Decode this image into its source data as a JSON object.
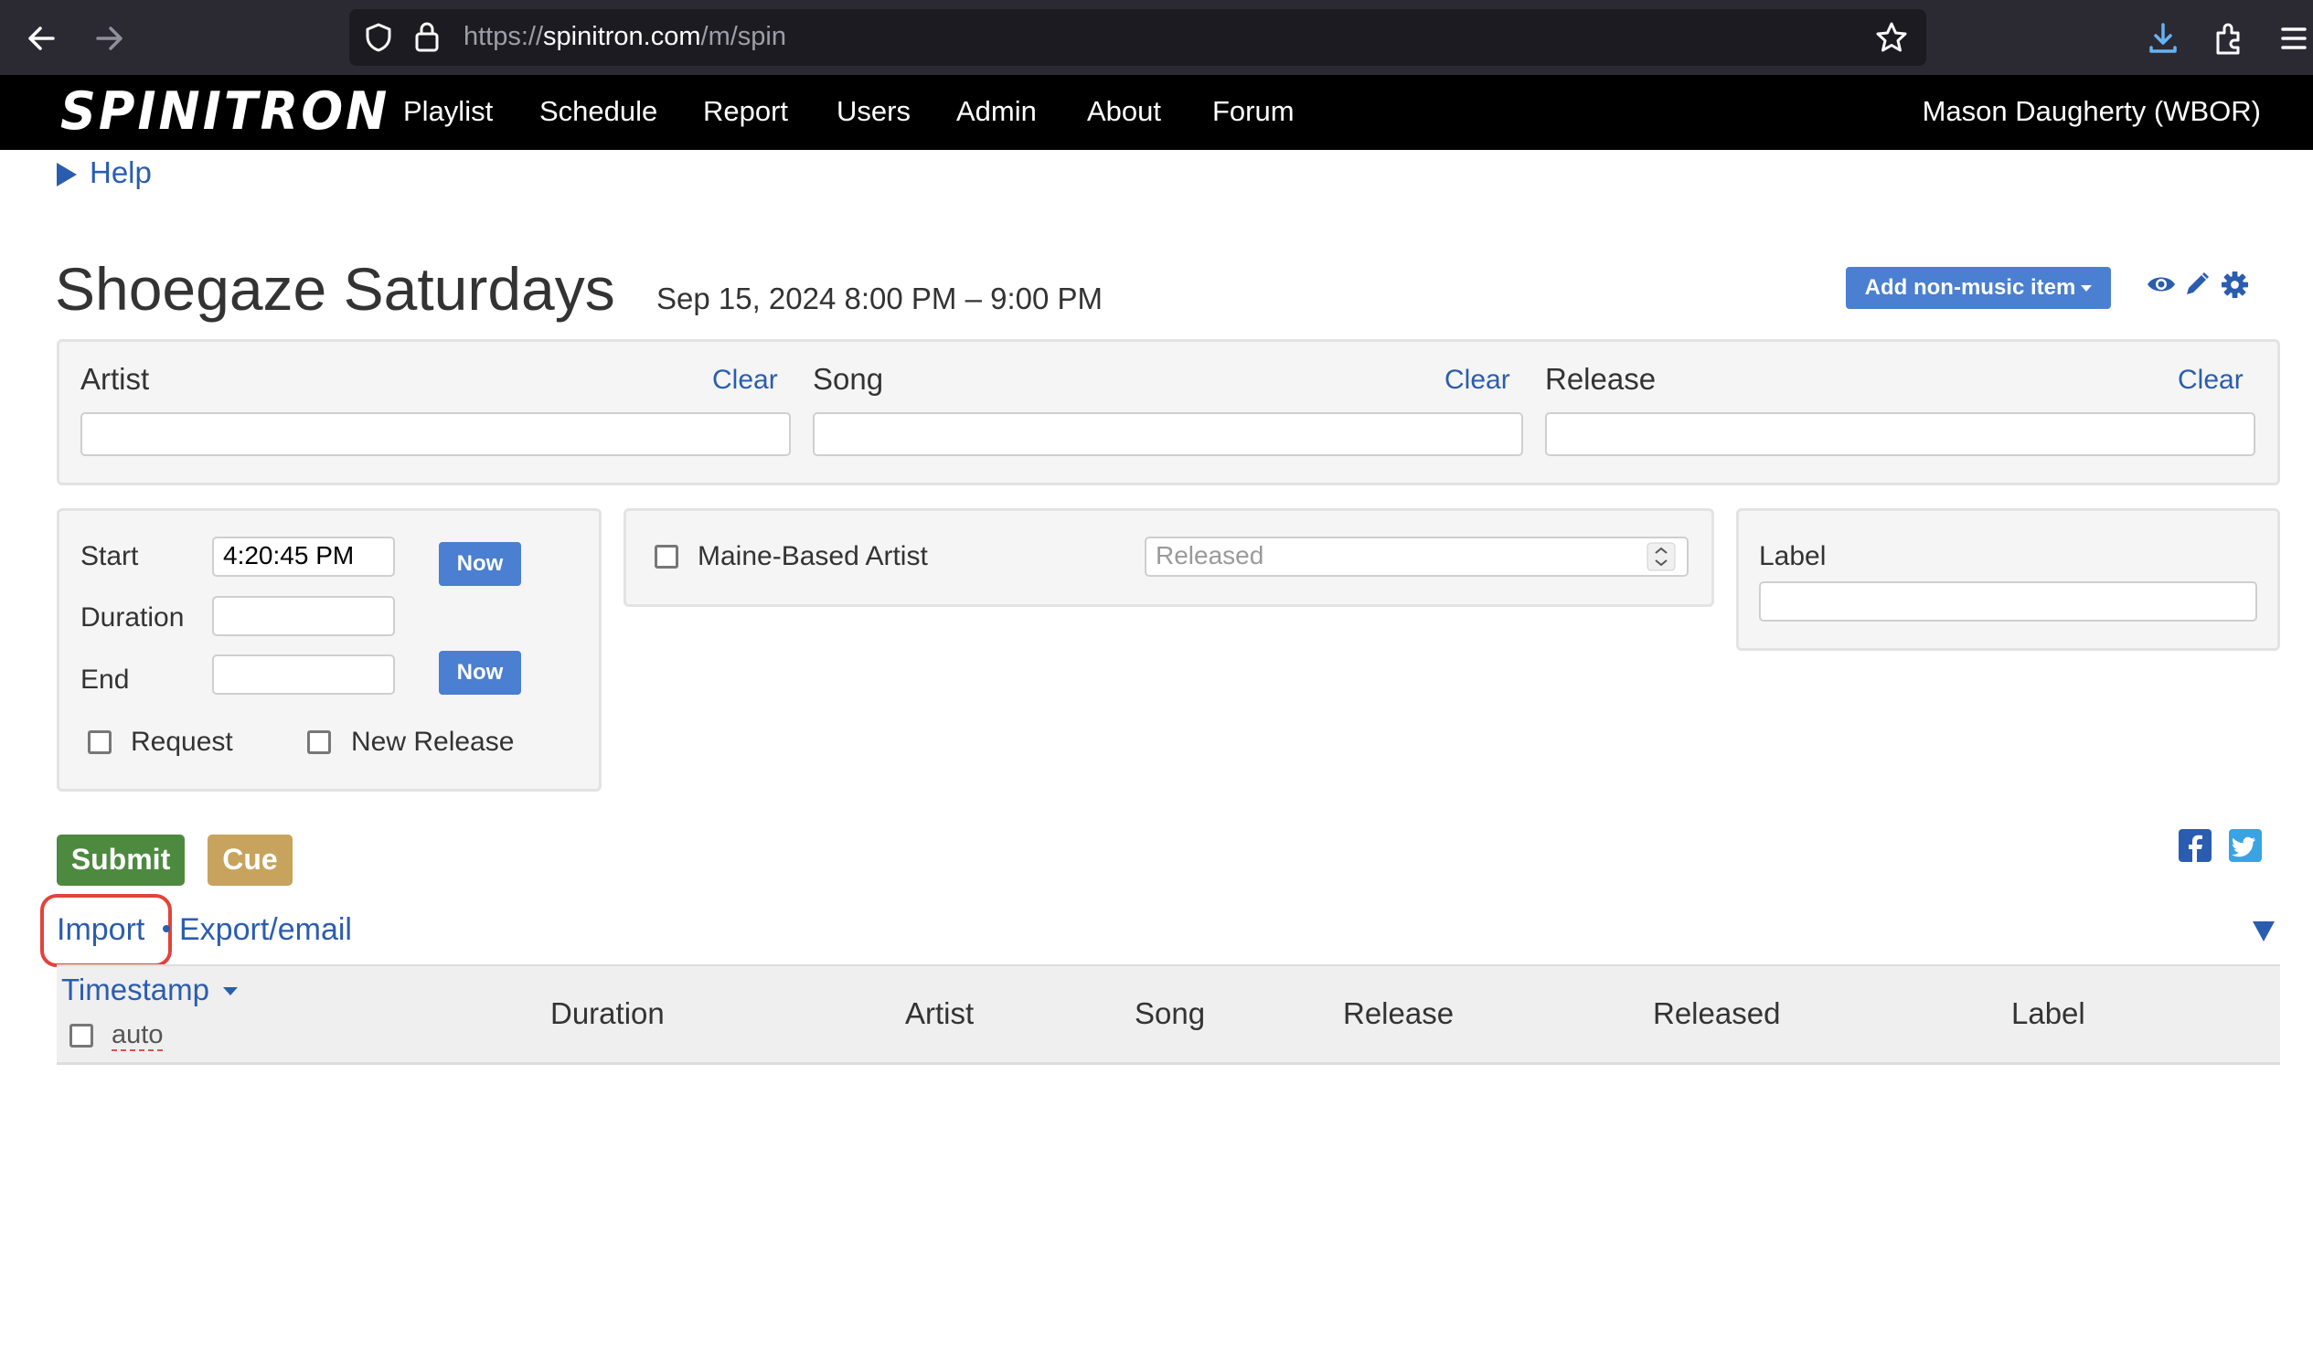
{
  "browser": {
    "url_prefix": "https://",
    "url_host": "spinitron.com",
    "url_path": "/m/spin"
  },
  "nav": {
    "logo": "SPINITRON",
    "items": [
      "Playlist",
      "Schedule",
      "Report",
      "Users",
      "Admin",
      "About",
      "Forum"
    ],
    "user": "Mason Daugherty (WBOR)"
  },
  "help": {
    "label": "Help"
  },
  "show": {
    "title": "Shoegaze Saturdays",
    "time": "Sep 15, 2024 8:00 PM – 9:00 PM",
    "add_nonmusic_label": "Add non-music item"
  },
  "search": {
    "artist_label": "Artist",
    "song_label": "Song",
    "release_label": "Release",
    "clear_label": "Clear",
    "artist_value": "",
    "song_value": "",
    "release_value": ""
  },
  "timing": {
    "start_label": "Start",
    "start_value": "4:20:45 PM",
    "duration_label": "Duration",
    "duration_value": "",
    "end_label": "End",
    "end_value": "",
    "now_label": "Now",
    "request_label": "Request",
    "new_release_label": "New Release"
  },
  "meta": {
    "maine_label": "Maine-Based Artist",
    "released_placeholder": "Released",
    "label_label": "Label",
    "label_value": ""
  },
  "actions": {
    "submit_label": "Submit",
    "cue_label": "Cue",
    "import_label": "Import",
    "export_label": "Export/email"
  },
  "table": {
    "timestamp": "Timestamp",
    "auto": "auto",
    "columns": [
      "Duration",
      "Artist",
      "Song",
      "Release",
      "Released",
      "Label"
    ]
  },
  "colors": {
    "link": "#2a5db0",
    "primary_button": "#4a7fd1",
    "submit": "#4d8a3f",
    "cue": "#c7a35e",
    "highlight": "#e0443a"
  }
}
